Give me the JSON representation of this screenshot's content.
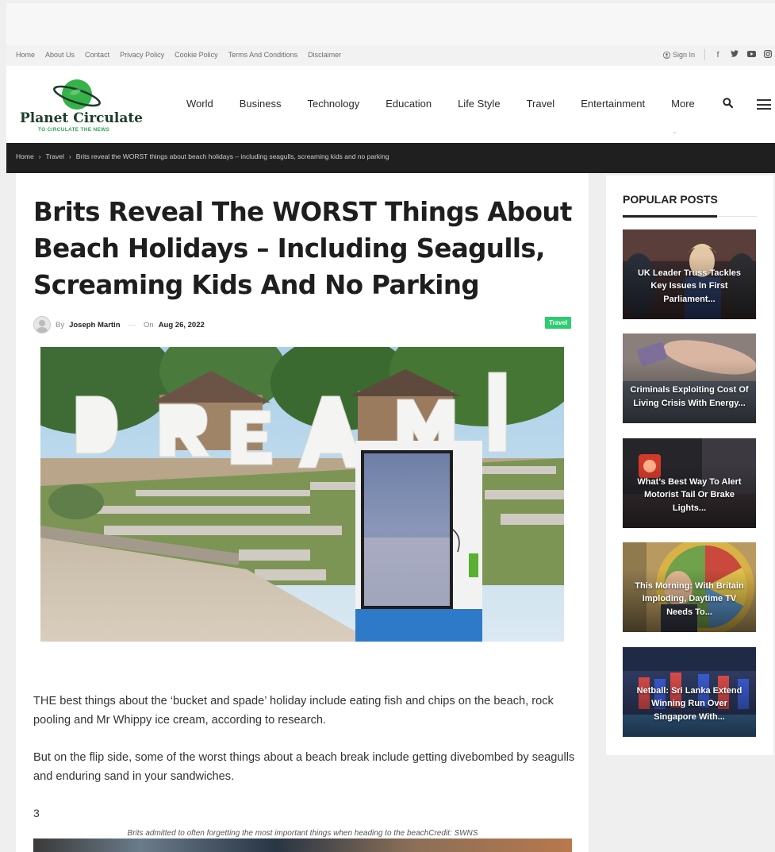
{
  "topbar": {
    "links": [
      "Home",
      "About Us",
      "Contact",
      "Privacy Policy",
      "Cookie Policy",
      "Terms And Conditions",
      "Disclaimer"
    ],
    "signin": "Sign In",
    "social": [
      "facebook-icon",
      "twitter-icon",
      "youtube-icon",
      "instagram-icon"
    ]
  },
  "logo": {
    "title": "Planet Circulate",
    "tagline": "TO CIRCULATE THE NEWS",
    "color": "#2ea44f"
  },
  "nav": {
    "items": [
      "World",
      "Business",
      "Technology",
      "Education",
      "Life Style",
      "Travel",
      "Entertainment",
      "More"
    ]
  },
  "breadcrumb": {
    "items": [
      "Home",
      "Travel",
      "Brits reveal the WORST things about beach holidays – including seagulls, screaming kids and no parking"
    ],
    "separator": "›"
  },
  "article": {
    "title": "Brits Reveal The WORST Things About Beach Holidays – Including Seagulls, Screaming Kids And No Parking",
    "by": "By",
    "author": "Joseph Martin",
    "on": "On",
    "date": "Aug 26, 2022",
    "category": "Travel",
    "category_color": "#2ecc71",
    "hero_sign": "DREAML",
    "paragraphs": [
      "THE best things about the ‘bucket and spade’ holiday include eating fish and chips on the beach, rock pooling and Mr Whippy ice cream, according to research.",
      "But on the flip side, some of the worst things about a beach break include getting divebombed by seagulls and enduring sand in your sandwiches."
    ],
    "number": "3",
    "caption": "Brits admitted to often forgetting the most important things when heading to the beachCredit: SWNS"
  },
  "sidebar": {
    "title": "POPULAR POSTS",
    "posts": [
      {
        "title": "UK Leader Truss Tackles Key Issues In First Parliament..."
      },
      {
        "title": "Criminals Exploiting Cost Of Living Crisis With Energy..."
      },
      {
        "title": "What’s Best Way To Alert Motorist Tail Or Brake Lights..."
      },
      {
        "title": "This Morning: With Britain Imploding, Daytime TV Needs To..."
      },
      {
        "title": "Netball: Sri Lanka Extend Winning Run Over Singapore With..."
      }
    ]
  }
}
